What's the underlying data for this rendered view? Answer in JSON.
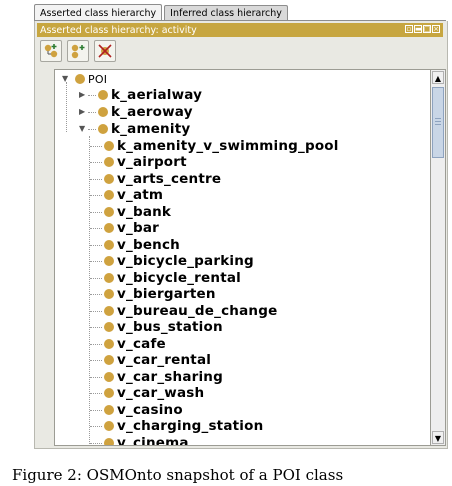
{
  "tabs": [
    {
      "label": "Asserted class hierarchy",
      "active": true
    },
    {
      "label": "Inferred class hierarchy",
      "active": false
    }
  ],
  "view_title": "Asserted class hierarchy: activity",
  "window_buttons": [
    "restore",
    "minimize",
    "maximize",
    "close"
  ],
  "toolbar": [
    {
      "icon": "add-subclass-icon",
      "tooltip": "Add subclass"
    },
    {
      "icon": "add-sibling-icon",
      "tooltip": "Add sibling class"
    },
    {
      "icon": "delete-class-icon",
      "tooltip": "Delete class"
    }
  ],
  "tree": {
    "root": "POI",
    "top_children": [
      "k_aerialway",
      "k_aeroway",
      "k_amenity"
    ],
    "amenity_children": [
      "k_amenity_v_swimming_pool",
      "v_airport",
      "v_arts_centre",
      "v_atm",
      "v_bank",
      "v_bar",
      "v_bench",
      "v_bicycle_parking",
      "v_bicycle_rental",
      "v_biergarten",
      "v_bureau_de_change",
      "v_bus_station",
      "v_cafe",
      "v_car_rental",
      "v_car_sharing",
      "v_car_wash",
      "v_casino",
      "v_charging_station",
      "v_cinema"
    ]
  },
  "caption": "Figure 2: OSMOnto snapshot of a POI class",
  "colors": {
    "header": "#c7a640",
    "class_dot": "#cfa23f"
  }
}
